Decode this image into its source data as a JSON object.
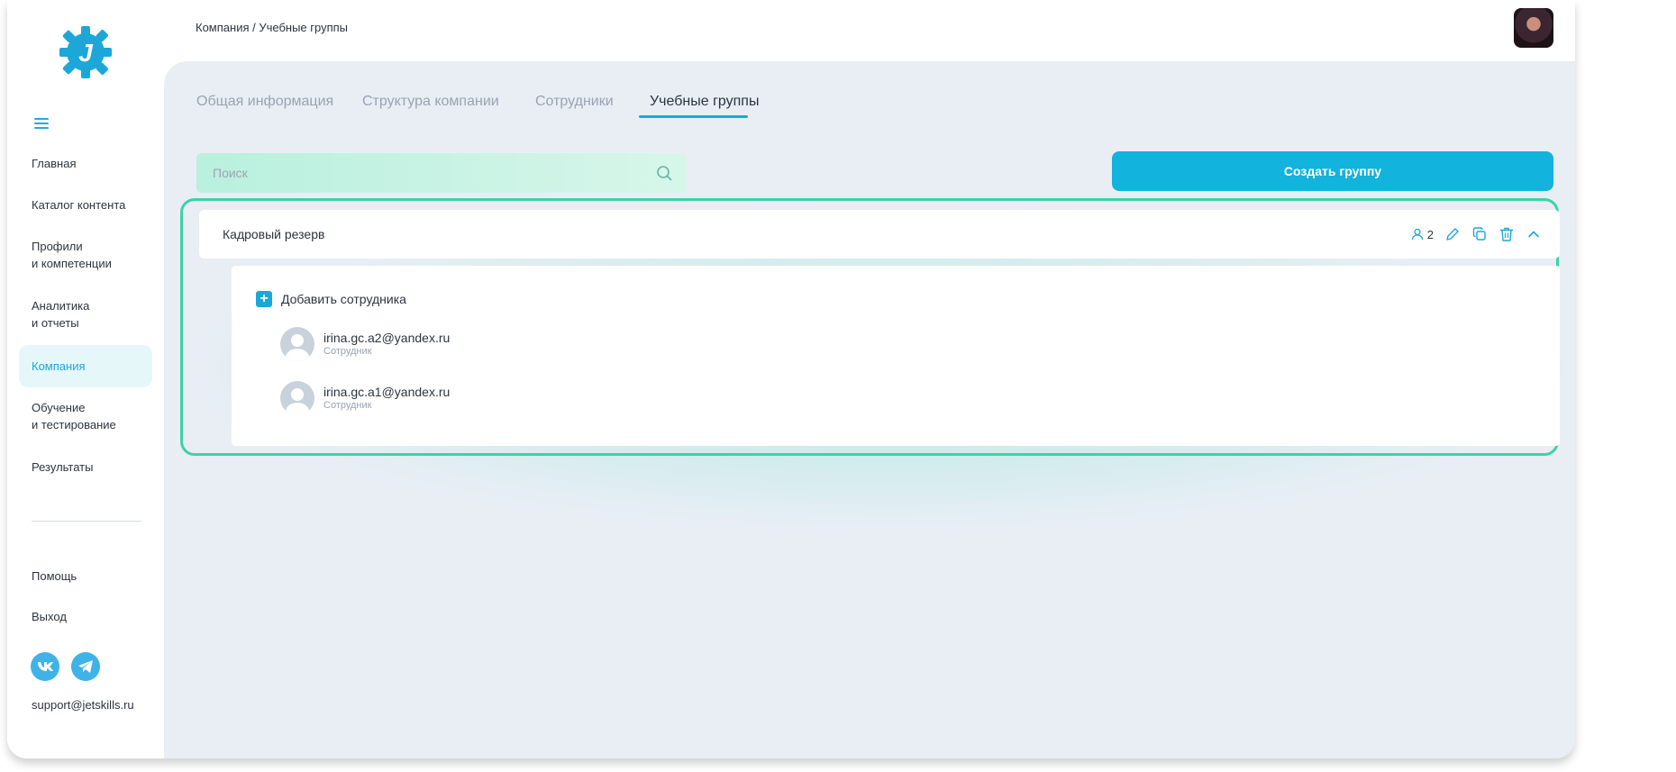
{
  "breadcrumb": "Компания / Учебные группы",
  "logo": {
    "letter": "J",
    "color": "#1ca7d8"
  },
  "sidebar": {
    "items": [
      {
        "label": "Главная",
        "active": false
      },
      {
        "label": "Каталог контента",
        "active": false
      },
      {
        "label": "Профили\nи компетенции",
        "active": false
      },
      {
        "label": "Аналитика\nи отчеты",
        "active": false
      },
      {
        "label": "Компания",
        "active": true
      },
      {
        "label": "Обучение\nи тестирование",
        "active": false
      },
      {
        "label": "Результаты",
        "active": false
      }
    ],
    "help": "Помощь",
    "logout": "Выход",
    "social": {
      "vk": "vk-icon",
      "telegram": "telegram-icon"
    },
    "support_email": "support@jetskills.ru"
  },
  "tabs": [
    {
      "label": "Общая информация",
      "active": false
    },
    {
      "label": "Структура компании",
      "active": false
    },
    {
      "label": "Сотрудники",
      "active": false
    },
    {
      "label": "Учебные группы",
      "active": true
    }
  ],
  "search": {
    "placeholder": "Поиск",
    "value": ""
  },
  "create_button": "Создать группу",
  "group": {
    "title": "Кадровый резерв",
    "member_count": "2",
    "add_member_label": "Добавить сотрудника",
    "members": [
      {
        "email": "irina.gc.a2@yandex.ru",
        "role": "Сотрудник"
      },
      {
        "email": "irina.gc.a1@yandex.ru",
        "role": "Сотрудник"
      }
    ]
  },
  "colors": {
    "accent": "#1ca7d8",
    "highlight": "#3fd1a8",
    "background": "#e9eef5"
  }
}
